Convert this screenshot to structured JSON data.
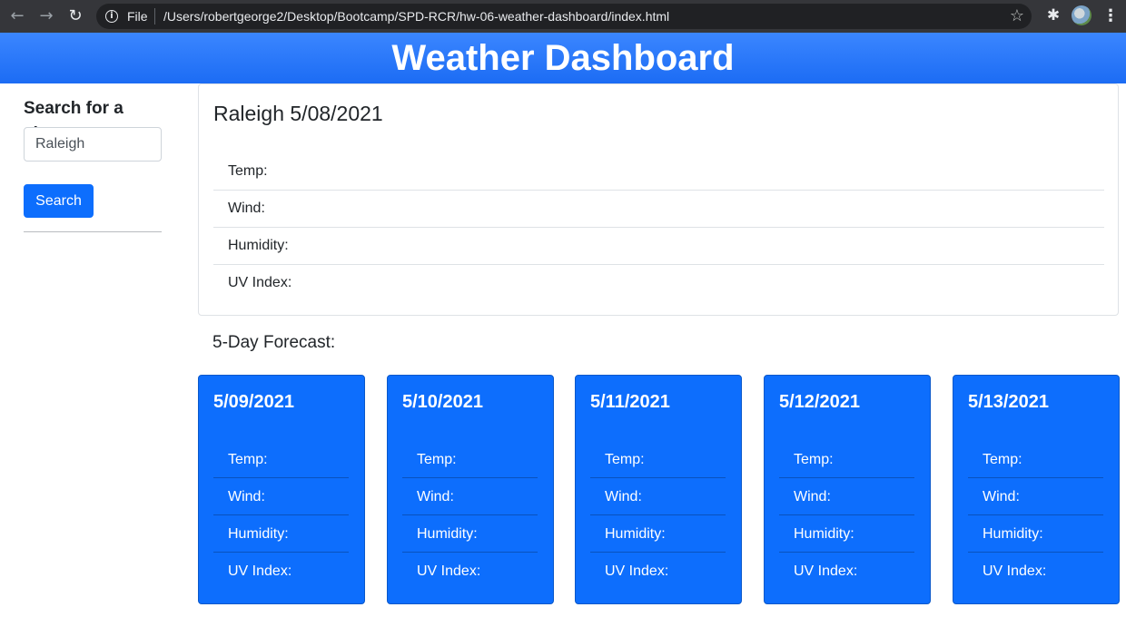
{
  "browser": {
    "scheme": "File",
    "url": "/Users/robertgeorge2/Desktop/Bootcamp/SPD-RCR/hw-06-weather-dashboard/index.html"
  },
  "header": {
    "title": "Weather Dashboard"
  },
  "sidebar": {
    "label": "Search for a city:",
    "input_value": "Raleigh",
    "button_label": "Search"
  },
  "current": {
    "title": "Raleigh 5/08/2021",
    "fields": [
      "Temp:",
      "Wind:",
      "Humidity:",
      "UV Index:"
    ]
  },
  "forecast": {
    "heading": "5-Day Forecast:",
    "days": [
      {
        "date": "5/09/2021",
        "fields": [
          "Temp:",
          "Wind:",
          "Humidity:",
          "UV Index:"
        ]
      },
      {
        "date": "5/10/2021",
        "fields": [
          "Temp:",
          "Wind:",
          "Humidity:",
          "UV Index:"
        ]
      },
      {
        "date": "5/11/2021",
        "fields": [
          "Temp:",
          "Wind:",
          "Humidity:",
          "UV Index:"
        ]
      },
      {
        "date": "5/12/2021",
        "fields": [
          "Temp:",
          "Wind:",
          "Humidity:",
          "UV Index:"
        ]
      },
      {
        "date": "5/13/2021",
        "fields": [
          "Temp:",
          "Wind:",
          "Humidity:",
          "UV Index:"
        ]
      }
    ]
  },
  "colors": {
    "primary": "#0d6efd",
    "header": "#1c6cf4",
    "chrome": "#35363a"
  },
  "icons": [
    "back-arrow-icon",
    "forward-arrow-icon",
    "reload-icon",
    "info-icon",
    "star-icon",
    "extensions-icon",
    "avatar",
    "menu-icon"
  ]
}
